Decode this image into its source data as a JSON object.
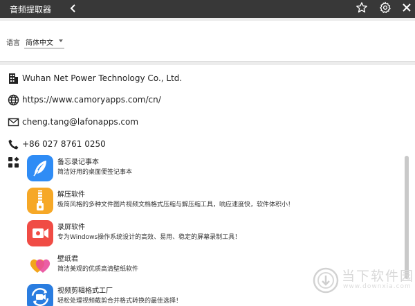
{
  "window": {
    "title": "音频提取器"
  },
  "settings": {
    "language_label": "语言",
    "language_value": "简体中文"
  },
  "about": {
    "company": "Wuhan Net Power Technology Co., Ltd.",
    "website": "https://www.camoryapps.com/cn/",
    "email": "cheng.tang@lafonapps.com",
    "phone": "+86 027 8761 0250"
  },
  "apps": [
    {
      "name": "备忘录记事本",
      "desc": "简洁好用的桌面便签记事本",
      "icon": "feather-icon",
      "color": "#2f8cf5"
    },
    {
      "name": "解压软件",
      "desc": "极简风格的多种文件图片视频文档格式压缩与解压缩工具，响应速度快，软件体积小！",
      "icon": "zip-icon",
      "color": "#f6a827"
    },
    {
      "name": "录屏软件",
      "desc": "专为Windows操作系统设计的高效、易用、稳定的屏幕录制工具！",
      "icon": "record-icon",
      "color": "#f04c45"
    },
    {
      "name": "壁纸君",
      "desc": "简洁美观的优质高清壁纸软件",
      "icon": "hearts-icon",
      "color": "#ee4fa0"
    },
    {
      "name": "视频剪辑格式工厂",
      "desc": "轻松处理视频截剪合并格式转换的最佳选择！",
      "icon": "video-convert-icon",
      "color": "#2a7de0"
    }
  ],
  "watermark": {
    "name": "当下软件园",
    "url": "www.downxia.com"
  }
}
